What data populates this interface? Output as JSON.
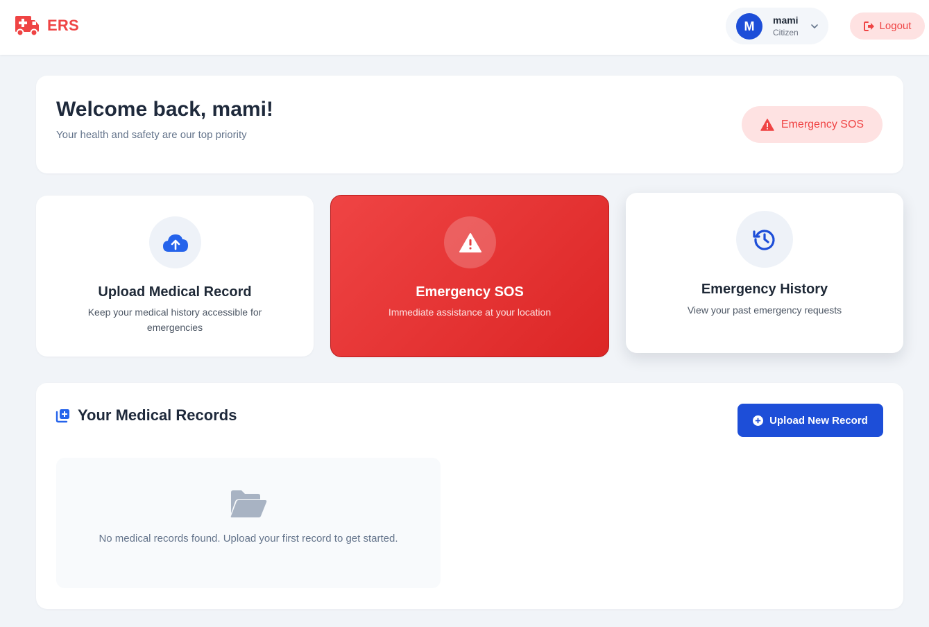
{
  "header": {
    "brand": "ERS",
    "user": {
      "initial": "M",
      "name": "mami",
      "role": "Citizen"
    },
    "logout_label": "Logout"
  },
  "welcome": {
    "title": "Welcome back, mami!",
    "subtitle": "Your health and safety are our top priority",
    "sos_button": "Emergency SOS"
  },
  "features": [
    {
      "title": "Upload Medical Record",
      "desc": "Keep your medical history accessible for emergencies"
    },
    {
      "title": "Emergency SOS",
      "desc": "Immediate assistance at your location"
    },
    {
      "title": "Emergency History",
      "desc": "View your past emergency requests"
    }
  ],
  "records": {
    "title": "Your Medical Records",
    "upload_button": "Upload New Record",
    "empty_text": "No medical records found. Upload your first record to get started."
  },
  "colors": {
    "brand_red": "#ef4444",
    "primary_blue": "#1d4ed8",
    "page_bg": "#f1f4f8"
  }
}
